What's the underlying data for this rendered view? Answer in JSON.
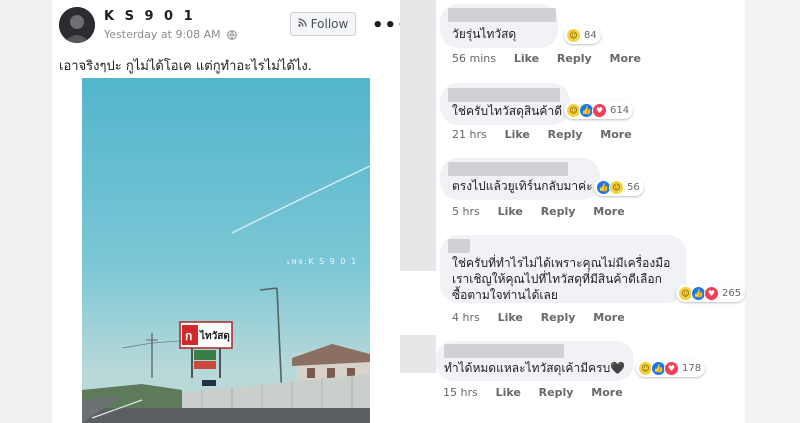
{
  "post": {
    "author": "K S 9 0 1",
    "timestamp": "Yesterday at 9:08 AM",
    "follow_label": "Follow",
    "more_label": "•••",
    "text": "เอาจริงๆปะ กูไม่ได้โอเค แต่กูทำอะไรไม่ได้ไง.",
    "photo": {
      "watermark": "เพจ:K S 9 0 1",
      "billboard_text": "ไทวัสดุ"
    }
  },
  "comments": [
    {
      "text": "วัยรุ่นไทวัสดุ",
      "reaction_count": "84",
      "reactions": [
        "haha"
      ],
      "time": "56 mins",
      "like": "Like",
      "reply": "Reply",
      "more": "More"
    },
    {
      "text": "ใช่ครับไทวัสดุสินค้าดี",
      "reaction_count": "614",
      "reactions": [
        "haha",
        "like",
        "love"
      ],
      "time": "21 hrs",
      "like": "Like",
      "reply": "Reply",
      "more": "More"
    },
    {
      "text": "ตรงไปแล้วยูเทิร์นกลับมาค่ะ",
      "reaction_count": "56",
      "reactions": [
        "like",
        "haha"
      ],
      "time": "5 hrs",
      "like": "Like",
      "reply": "Reply",
      "more": "More"
    },
    {
      "lines": [
        "ใช่ครับที่ทำไรไม่ได้เพราะคุณไม่มีเครื่องมือ",
        "เราเชิญให้คุณไปที่ไทวัสดุที่มีสินค้าดีเลือก",
        "ซื้อตามใจท่านได้เลย"
      ],
      "reaction_count": "265",
      "reactions": [
        "haha",
        "like",
        "love"
      ],
      "time": "4 hrs",
      "like": "Like",
      "reply": "Reply",
      "more": "More"
    },
    {
      "text": "ทำได้หมดแหละไทวัสดุเค้ามีครบ🖤",
      "reaction_count": "178",
      "reactions": [
        "haha",
        "like",
        "love"
      ],
      "time": "15 hrs",
      "like": "Like",
      "reply": "Reply",
      "more": "More"
    }
  ],
  "colors": {
    "like": "#1877f2",
    "love": "#f33e58",
    "haha": "#f7d13d",
    "bubble": "#f0f2f5",
    "meta": "#65676b"
  }
}
